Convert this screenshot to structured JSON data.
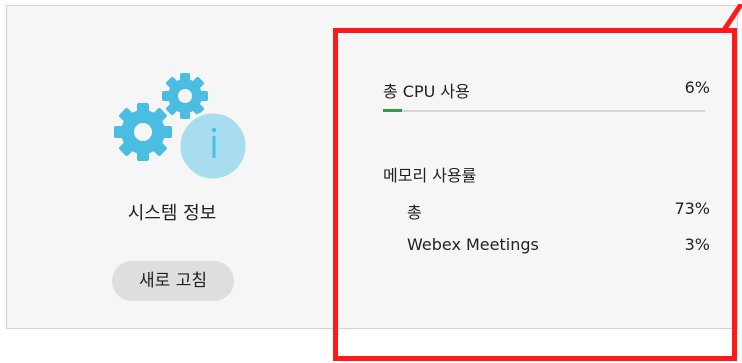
{
  "left_panel": {
    "title": "시스템 정보",
    "icon": "gears-info-icon",
    "refresh_button": "새로 고침"
  },
  "cpu": {
    "label": "총 CPU 사용",
    "value": "6%",
    "fraction": 0.06
  },
  "memory": {
    "heading": "메모리 사용률",
    "items": [
      {
        "label": "총",
        "value": "73%"
      },
      {
        "label": "Webex Meetings",
        "value": "3%"
      }
    ]
  },
  "colors": {
    "panel_bg": "#f6f6f6",
    "gear_blue": "#4bbde2",
    "info_circle": "#a8ddf0",
    "progress_green": "#2e9e3e",
    "highlight_red": "#ff1a1a"
  }
}
